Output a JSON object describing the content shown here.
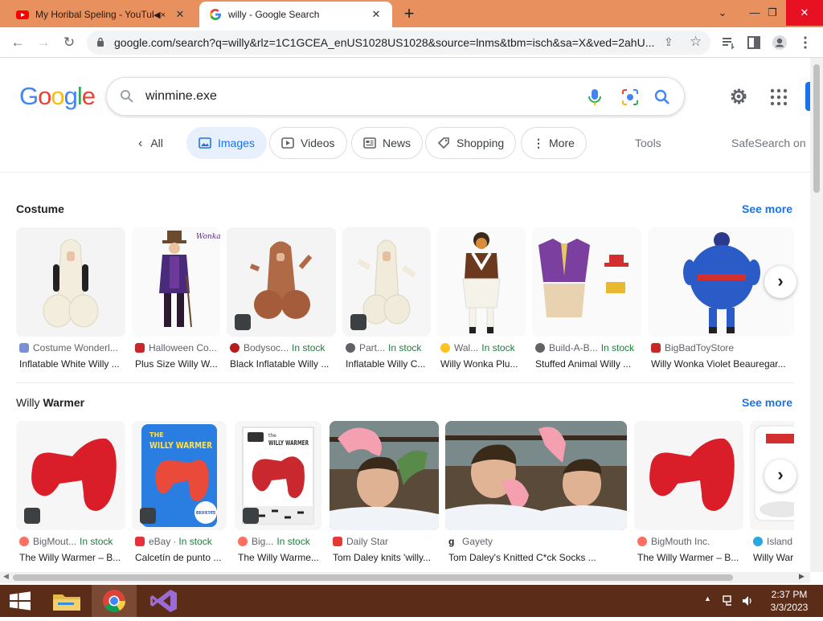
{
  "browser": {
    "tabs": [
      {
        "title": "My Horibal Speling - YouTub",
        "active": false
      },
      {
        "title": "willy - Google Search",
        "active": true
      }
    ],
    "url": "google.com/search?q=willy&rlz=1C1GCEA_enUS1028US1028&source=lnms&tbm=isch&sa=X&ved=2ahU..."
  },
  "google": {
    "logo": "Google",
    "query": "winmine.exe",
    "chips": {
      "all": "All",
      "images": "Images",
      "videos": "Videos",
      "news": "News",
      "shopping": "Shopping",
      "more": "More"
    },
    "tools": "Tools",
    "safesearch": "SafeSearch on"
  },
  "sections": [
    {
      "title": "Costume",
      "see_more": "See more",
      "cards": [
        {
          "source": "Costume Wonderl...",
          "in_stock": "",
          "title": "Inflatable White Willy ..."
        },
        {
          "source": "Halloween Co...",
          "in_stock": "",
          "title": "Plus Size Willy W..."
        },
        {
          "source": "Bodysoc...",
          "in_stock": "In stock",
          "title": "Black Inflatable Willy ..."
        },
        {
          "source": "Part...",
          "in_stock": "In stock",
          "title": "Inflatable Willy C..."
        },
        {
          "source": "Wal...",
          "in_stock": "In stock",
          "title": "Willy Wonka Plu..."
        },
        {
          "source": "Build-A-B...",
          "in_stock": "In stock",
          "title": "Stuffed Animal Willy ..."
        },
        {
          "source": "BigBadToyStore",
          "in_stock": "",
          "title": "Willy Wonka Violet Beauregar..."
        }
      ]
    },
    {
      "title_plain": "Willy ",
      "title_bold": "Warmer",
      "see_more": "See more",
      "cards": [
        {
          "source": "BigMout...",
          "in_stock": "In stock",
          "title": "The Willy Warmer – B..."
        },
        {
          "source": "eBay",
          "in_stock": "In stock",
          "title": "Calcetín de punto ..."
        },
        {
          "source": "Big...",
          "in_stock": "In stock",
          "title": "The Willy Warme..."
        },
        {
          "source": "Daily Star",
          "in_stock": "",
          "title": "Tom Daley knits 'willy..."
        },
        {
          "source": "Gayety",
          "in_stock": "",
          "title": "Tom Daley's Knitted C*ck Socks ..."
        },
        {
          "source": "BigMouth Inc.",
          "in_stock": "",
          "title": "The Willy Warmer – B..."
        },
        {
          "source": "Island",
          "in_stock": "",
          "title": "Willy War"
        }
      ]
    }
  ],
  "product_text": {
    "willy_wonka_mark": "Wonka",
    "willy_warmer_box_brand": "THE",
    "willy_warmer_box_title": "WILLY WARMER",
    "willy_warmer_badge": "NEVER SAY NO TO PETER",
    "bigmouth_card_brand": "the",
    "bigmouth_card_title": "WILLY WARMER"
  },
  "taskbar": {
    "time": "2:37 PM",
    "date": "3/3/2023"
  },
  "colors": {
    "tabstrip": "#e8915e",
    "taskbar": "#5b2c18",
    "accent": "#1a73e8",
    "in_stock": "#188038"
  }
}
